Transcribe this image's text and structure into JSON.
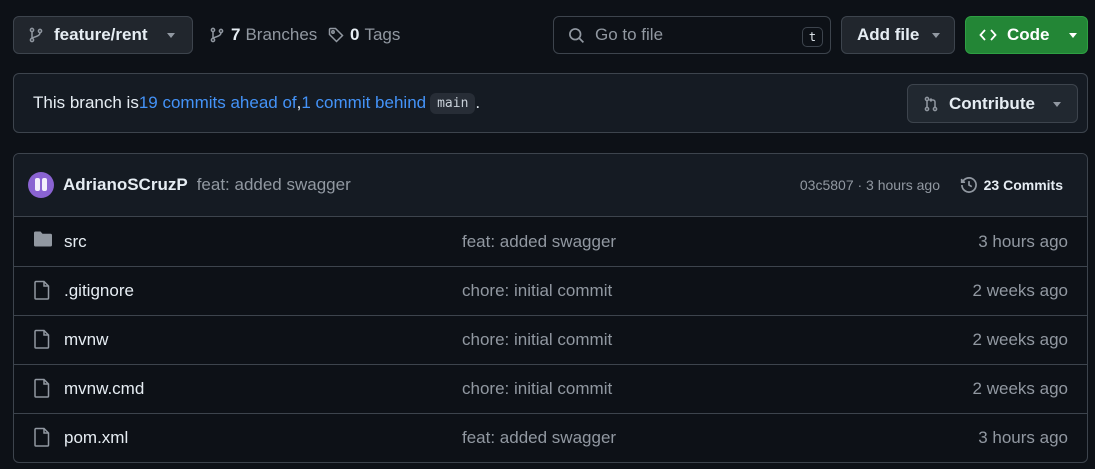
{
  "toolbar": {
    "branch_name": "feature/rent",
    "branches_count": "7",
    "branches_label": "Branches",
    "tags_count": "0",
    "tags_label": "Tags",
    "search_placeholder": "Go to file",
    "search_shortcut": "t",
    "add_file_label": "Add file",
    "code_label": "Code"
  },
  "banner": {
    "prefix": "This branch is ",
    "ahead_link": "19 commits ahead of",
    "separator": ", ",
    "behind_link": "1 commit behind",
    "base_branch": "main",
    "suffix": ".",
    "contribute_label": "Contribute"
  },
  "latest_commit": {
    "author": "AdrianoSCruzP",
    "message": "feat: added swagger",
    "meta": "03c5807 · 3 hours ago",
    "commits_label": "23 Commits"
  },
  "files": [
    {
      "name": "src",
      "type": "folder",
      "message": "feat: added swagger",
      "date": "3 hours ago"
    },
    {
      "name": ".gitignore",
      "type": "file",
      "message": "chore: initial commit",
      "date": "2 weeks ago"
    },
    {
      "name": "mvnw",
      "type": "file",
      "message": "chore: initial commit",
      "date": "2 weeks ago"
    },
    {
      "name": "mvnw.cmd",
      "type": "file",
      "message": "chore: initial commit",
      "date": "2 weeks ago"
    },
    {
      "name": "pom.xml",
      "type": "file",
      "message": "feat: added swagger",
      "date": "3 hours ago"
    }
  ],
  "colors": {
    "background": "#0d1117",
    "surface": "#151b23",
    "border": "#3d444d",
    "link": "#4493f8",
    "primary_button": "#238636",
    "muted_text": "#9198a1"
  },
  "icons": {
    "branch": "git-branch-icon",
    "tag": "tag-icon",
    "search": "search-icon",
    "code": "code-icon",
    "contribute": "pull-request-icon",
    "history": "history-icon",
    "folder": "folder-icon",
    "file": "file-icon"
  }
}
